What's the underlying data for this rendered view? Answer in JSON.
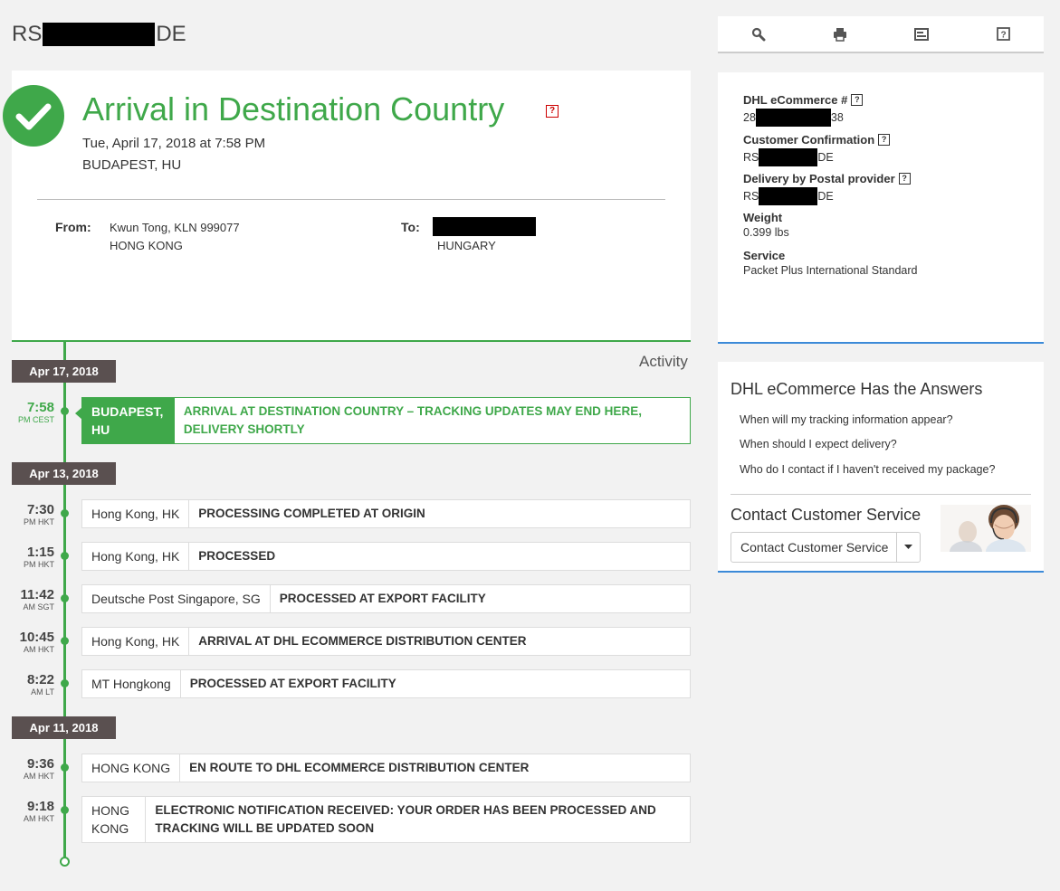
{
  "tracking": {
    "prefix": "RS",
    "suffix": "DE"
  },
  "status": {
    "title": "Arrival in Destination Country",
    "help": "?",
    "date": "Tue, April 17, 2018 at 7:58 PM",
    "location": "BUDAPEST, HU",
    "from_label": "From:",
    "from_line1": "Kwun Tong, KLN 999077",
    "from_line2": "HONG KONG",
    "to_label": "To:",
    "to_line2": "HUNGARY"
  },
  "activity_label": "Activity",
  "timeline": {
    "dates": [
      "Apr 17, 2018",
      "Apr 13, 2018",
      "Apr 11, 2018"
    ],
    "events": [
      {
        "time": "7:58",
        "zone": "PM CEST",
        "location": "BUDAPEST, HU",
        "description": "ARRIVAL AT DESTINATION COUNTRY – TRACKING UPDATES MAY END HERE, DELIVERY SHORTLY"
      },
      {
        "time": "7:30",
        "zone": "PM HKT",
        "location": "Hong Kong, HK",
        "description": "PROCESSING COMPLETED AT ORIGIN"
      },
      {
        "time": "1:15",
        "zone": "PM HKT",
        "location": "Hong Kong, HK",
        "description": "PROCESSED"
      },
      {
        "time": "11:42",
        "zone": "AM SGT",
        "location": "Deutsche Post Singapore, SG",
        "description": "PROCESSED AT EXPORT FACILITY"
      },
      {
        "time": "10:45",
        "zone": "AM HKT",
        "location": "Hong Kong, HK",
        "description": "ARRIVAL AT DHL ECOMMERCE DISTRIBUTION CENTER"
      },
      {
        "time": "8:22",
        "zone": "AM LT",
        "location": "MT Hongkong",
        "description": "PROCESSED AT EXPORT FACILITY"
      },
      {
        "time": "9:36",
        "zone": "AM HKT",
        "location": "HONG KONG",
        "description": "EN ROUTE TO DHL ECOMMERCE DISTRIBUTION CENTER"
      },
      {
        "time": "9:18",
        "zone": "AM HKT",
        "location": "HONG KONG",
        "description": "ELECTRONIC NOTIFICATION RECEIVED: YOUR ORDER HAS BEEN PROCESSED AND TRACKING WILL BE UPDATED SOON"
      }
    ]
  },
  "toolbar": {
    "icons": [
      "search-icon",
      "print-icon",
      "email-icon",
      "help-icon"
    ]
  },
  "info": {
    "ecommerce_label": "DHL eCommerce #",
    "ecommerce_prefix": "28",
    "ecommerce_suffix": "38",
    "confirmation_label": "Customer Confirmation",
    "confirmation_prefix": "RS",
    "confirmation_suffix": "DE",
    "postal_label": "Delivery by Postal provider",
    "postal_prefix": "RS",
    "postal_suffix": "DE",
    "weight_label": "Weight",
    "weight_value": "0.399 lbs",
    "service_label": "Service",
    "service_value": "Packet Plus International Standard"
  },
  "answers": {
    "title": "DHL eCommerce Has the Answers",
    "faqs": [
      "When will my tracking information appear?",
      "When should I expect delivery?",
      "Who do I contact if I haven't received my package?"
    ],
    "contact_title": "Contact Customer Service",
    "contact_button": "Contact Customer Service"
  },
  "colors": {
    "accent": "#3fa84a",
    "badge": "#5a5050",
    "blue": "#3b8ad8",
    "help_red": "#cc0000"
  }
}
